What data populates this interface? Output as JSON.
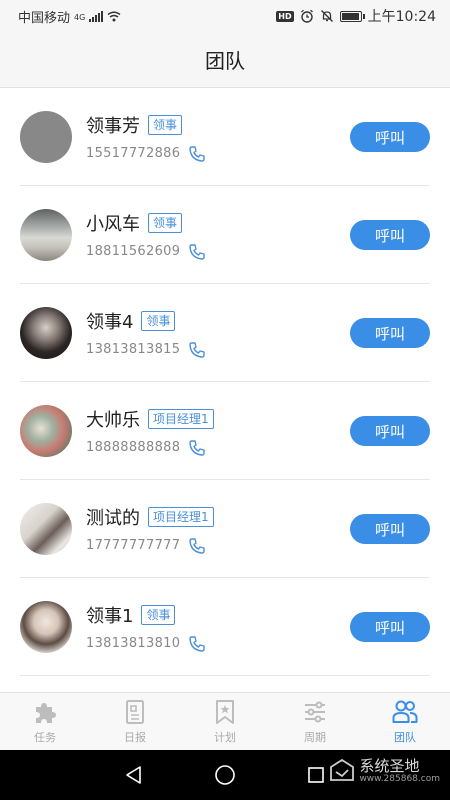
{
  "status_bar": {
    "carrier": "中国移动",
    "network": "4G",
    "hd": "HD",
    "time": "上午10:24",
    "battery_level": 0.85
  },
  "header": {
    "title": "团队"
  },
  "members": [
    {
      "name": "领事芳",
      "role": "领事",
      "phone": "15517772886",
      "call_label": "呼叫",
      "avatar": "avatar-gray-placeholder"
    },
    {
      "name": "小风车",
      "role": "领事",
      "phone": "18811562609",
      "call_label": "呼叫",
      "avatar": "avatar-photo"
    },
    {
      "name": "领事4",
      "role": "领事",
      "phone": "13813813815",
      "call_label": "呼叫",
      "avatar": "avatar-photo"
    },
    {
      "name": "大帅乐",
      "role": "项目经理1",
      "phone": "18888888888",
      "call_label": "呼叫",
      "avatar": "avatar-photo"
    },
    {
      "name": "测试的",
      "role": "项目经理1",
      "phone": "17777777777",
      "call_label": "呼叫",
      "avatar": "avatar-photo"
    },
    {
      "name": "领事1",
      "role": "领事",
      "phone": "13813813810",
      "call_label": "呼叫",
      "avatar": "avatar-photo"
    }
  ],
  "tabs": [
    {
      "label": "任务",
      "icon": "puzzle-icon",
      "active": false
    },
    {
      "label": "日报",
      "icon": "report-icon",
      "active": false
    },
    {
      "label": "计划",
      "icon": "bookmark-icon",
      "active": false
    },
    {
      "label": "周期",
      "icon": "sliders-icon",
      "active": false
    },
    {
      "label": "团队",
      "icon": "team-icon",
      "active": true
    }
  ],
  "watermark": {
    "text": "系统圣地",
    "url": "www.285868.com"
  },
  "colors": {
    "accent": "#3a8ee6",
    "tag": "#4a90d9",
    "inactive": "#aaaaaa"
  }
}
